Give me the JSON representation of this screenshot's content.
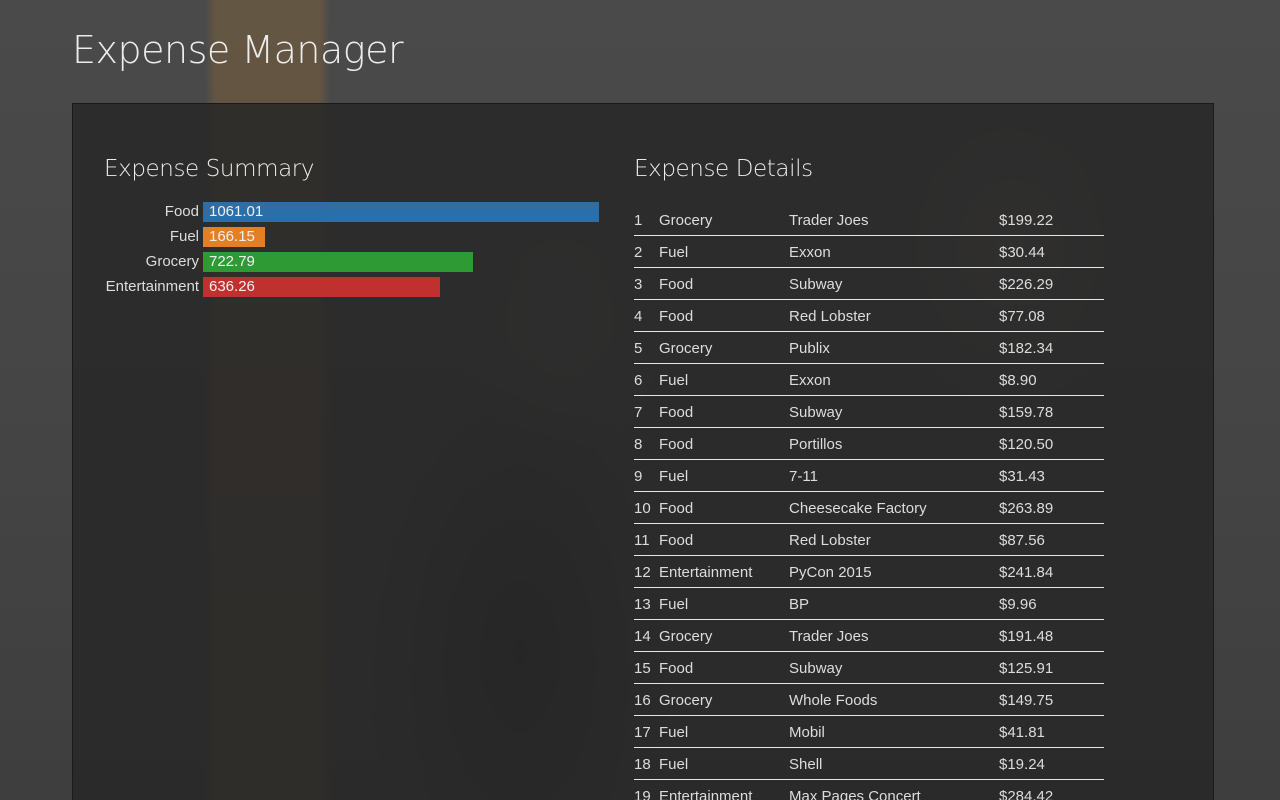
{
  "app": {
    "title": "Expense Manager"
  },
  "summary": {
    "title": "Expense Summary"
  },
  "details": {
    "title": "Expense Details",
    "rows": [
      {
        "num": "1",
        "category": "Grocery",
        "vendor": "Trader Joes",
        "amount": "$199.22"
      },
      {
        "num": "2",
        "category": "Fuel",
        "vendor": "Exxon",
        "amount": "$30.44"
      },
      {
        "num": "3",
        "category": "Food",
        "vendor": "Subway",
        "amount": "$226.29"
      },
      {
        "num": "4",
        "category": "Food",
        "vendor": "Red Lobster",
        "amount": "$77.08"
      },
      {
        "num": "5",
        "category": "Grocery",
        "vendor": "Publix",
        "amount": "$182.34"
      },
      {
        "num": "6",
        "category": "Fuel",
        "vendor": "Exxon",
        "amount": "$8.90"
      },
      {
        "num": "7",
        "category": "Food",
        "vendor": "Subway",
        "amount": "$159.78"
      },
      {
        "num": "8",
        "category": "Food",
        "vendor": "Portillos",
        "amount": "$120.50"
      },
      {
        "num": "9",
        "category": "Fuel",
        "vendor": "7-11",
        "amount": "$31.43"
      },
      {
        "num": "10",
        "category": "Food",
        "vendor": "Cheesecake Factory",
        "amount": "$263.89"
      },
      {
        "num": "11",
        "category": "Food",
        "vendor": "Red Lobster",
        "amount": "$87.56"
      },
      {
        "num": "12",
        "category": "Entertainment",
        "vendor": "PyCon 2015",
        "amount": "$241.84"
      },
      {
        "num": "13",
        "category": "Fuel",
        "vendor": "BP",
        "amount": "$9.96"
      },
      {
        "num": "14",
        "category": "Grocery",
        "vendor": "Trader Joes",
        "amount": "$191.48"
      },
      {
        "num": "15",
        "category": "Food",
        "vendor": "Subway",
        "amount": "$125.91"
      },
      {
        "num": "16",
        "category": "Grocery",
        "vendor": "Whole Foods",
        "amount": "$149.75"
      },
      {
        "num": "17",
        "category": "Fuel",
        "vendor": "Mobil",
        "amount": "$41.81"
      },
      {
        "num": "18",
        "category": "Fuel",
        "vendor": "Shell",
        "amount": "$19.24"
      },
      {
        "num": "19",
        "category": "Entertainment",
        "vendor": "Max Pages Concert",
        "amount": "$284.42"
      }
    ]
  },
  "chart_data": {
    "type": "bar",
    "orientation": "horizontal",
    "categories": [
      "Food",
      "Fuel",
      "Grocery",
      "Entertainment"
    ],
    "values": [
      1061.01,
      166.15,
      722.79,
      636.26
    ],
    "value_labels": [
      "1061.01",
      "166.15",
      "722.79",
      "636.26"
    ],
    "colors": [
      "#2c6fa8",
      "#e67e22",
      "#2e9a33",
      "#c0302f"
    ],
    "xlim": [
      0,
      1061.01
    ],
    "grid": false,
    "legend": "none"
  }
}
